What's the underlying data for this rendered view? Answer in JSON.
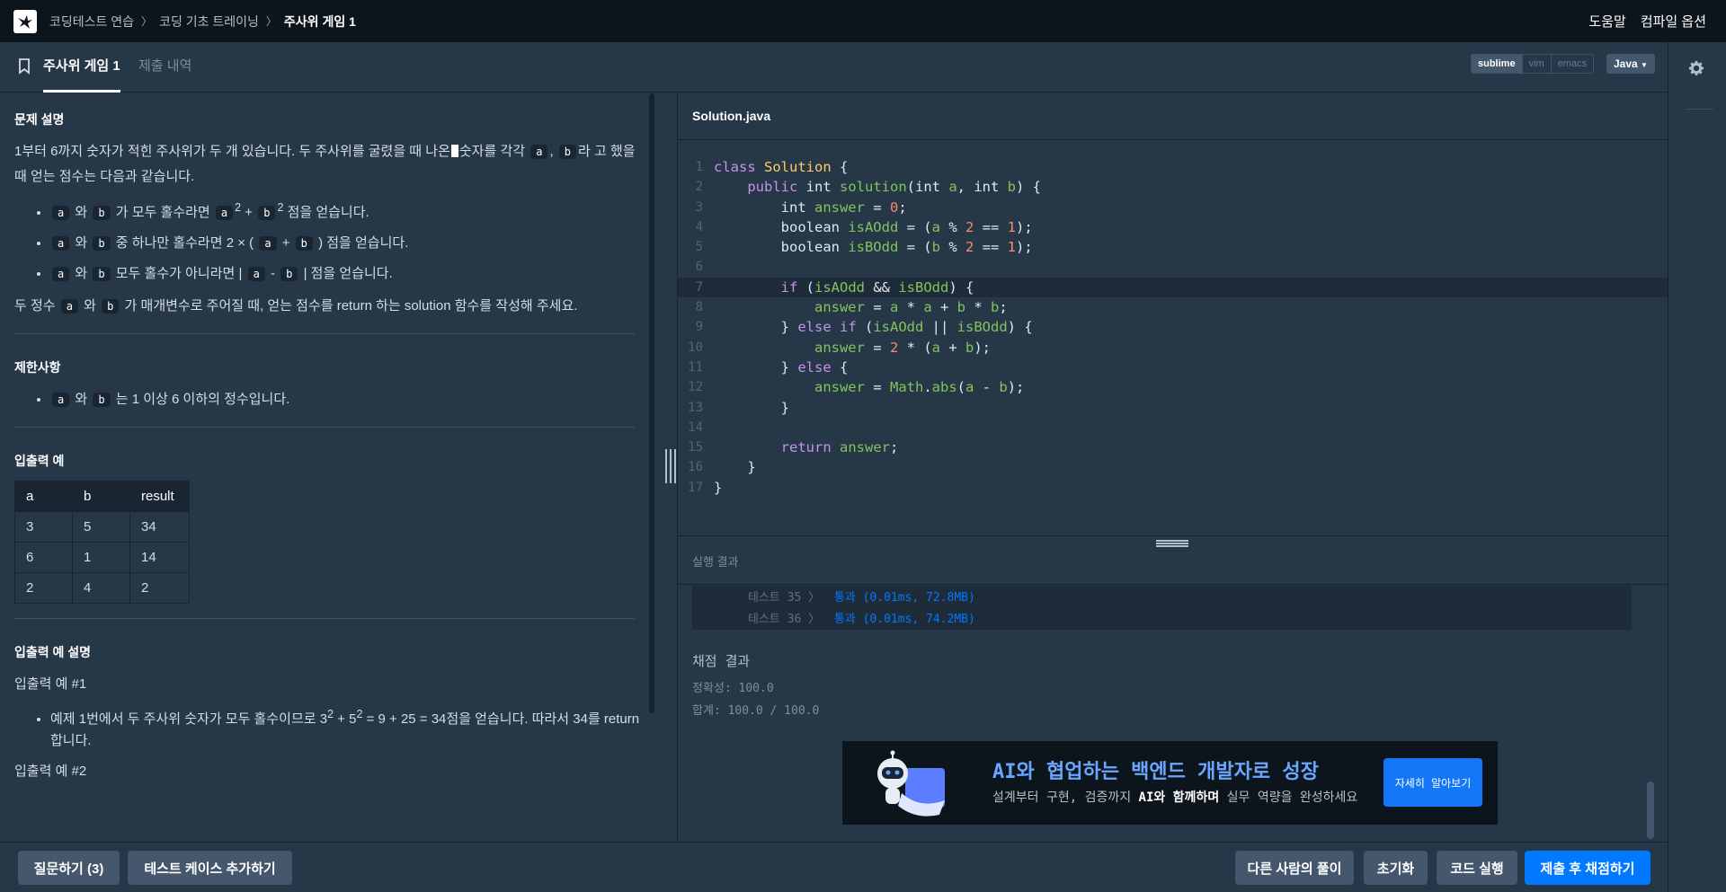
{
  "nav": {
    "breadcrumb": [
      "코딩테스트 연습",
      "코딩 기초 트레이닝",
      "주사위 게임 1"
    ],
    "help": "도움말",
    "compile_options": "컴파일 옵션"
  },
  "tabs": {
    "problem": "주사위 게임 1",
    "submissions": "제출 내역"
  },
  "editor_modes": [
    "sublime",
    "vim",
    "emacs"
  ],
  "language": "Java",
  "problem": {
    "desc_title": "문제 설명",
    "intro_1": "1부터 6까지 숫자가 적힌 주사위가 두 개 있습니다. 두 주사위를 굴렸을 때 나온",
    "intro_2": "숫자를 각각",
    "intro_3": "라",
    "intro_4": "고 했을 때 얻는 점수는 다음과 같습니다.",
    "var_a": "a",
    "var_b": "b",
    "comma": ",",
    "rule1_and": "와",
    "rule1_text": "가 모두 홀수라면",
    "rule1_end": "점을 얻습니다.",
    "sup2": "2",
    "plus": "+",
    "rule2_and": "와",
    "rule2_text": "중 하나만 홀수라면 2 × (",
    "rule2_close": ") 점을 얻습니다.",
    "rule3_and": "와",
    "rule3_text": "모두 홀수가 아니라면 |",
    "minus": "-",
    "rule3_end": "| 점을 얻습니다.",
    "task_1": "두 정수",
    "task_and": "와",
    "task_2": "가 매개변수로 주어질 때, 얻는 점수를 return 하는 solution 함수를 작성해 주세요.",
    "limits_title": "제한사항",
    "limit_and": "와",
    "limit_text": "는 1 이상 6 이하의 정수입니다.",
    "io_title": "입출력 예",
    "io_headers": [
      "a",
      "b",
      "result"
    ],
    "io_rows": [
      [
        "3",
        "5",
        "34"
      ],
      [
        "6",
        "1",
        "14"
      ],
      [
        "2",
        "4",
        "2"
      ]
    ],
    "io_desc_title": "입출력 예 설명",
    "ex1_title": "입출력 예 #1",
    "ex1_text_a": "예제 1번에서 두 주사위 숫자가 모두 홀수이므로 3",
    "ex1_text_b": " + 5",
    "ex1_text_c": " = 9 + 25 = 34점을 얻습니다. 따라서 34를 return 합니다.",
    "ex2_title": "입출력 예 #2"
  },
  "file_name": "Solution.java",
  "code_lines": [
    "1",
    "2",
    "3",
    "4",
    "5",
    "6",
    "7",
    "8",
    "9",
    "10",
    "11",
    "12",
    "13",
    "14",
    "15",
    "16",
    "17"
  ],
  "results": {
    "title": "실행 결과",
    "tests": [
      {
        "label": "테스트 35 〉",
        "result": "통과 (0.01ms, 72.8MB)"
      },
      {
        "label": "테스트 36 〉",
        "result": "통과 (0.01ms, 74.2MB)"
      }
    ],
    "grade_title": "채점 결과",
    "accuracy": "정확성: 100.0",
    "total": "합계: 100.0 / 100.0"
  },
  "banner": {
    "title": "AI와 협업하는 백엔드 개발자로 성장",
    "sub_a": "설계부터 구현, 검증까지 ",
    "sub_b": "AI와 함께하며",
    "sub_c": " 실무 역량을 완성하세요",
    "button": "자세히 알아보기"
  },
  "buttons": {
    "ask": "질문하기 (3)",
    "add_testcase": "테스트 케이스 추가하기",
    "others": "다른 사람의 풀이",
    "reset": "초기화",
    "run": "코드 실행",
    "submit": "제출 후 채점하기"
  },
  "colors": {
    "background": "#263747",
    "nav": "#0c151c",
    "primary": "#0078ff",
    "pass": "#0078ff"
  }
}
